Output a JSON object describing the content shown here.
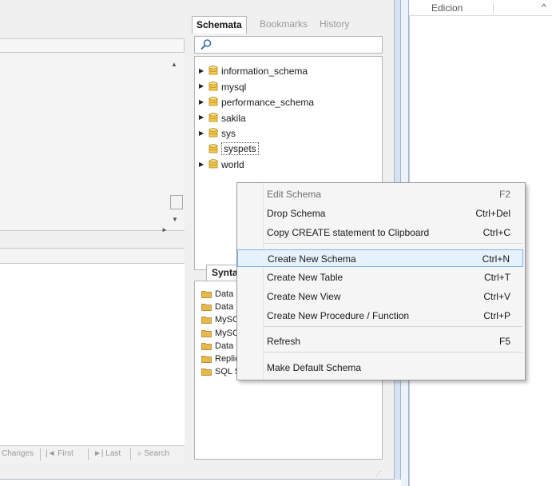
{
  "right_panel": {
    "header_label": "Edicion",
    "caret": "^"
  },
  "left_toolbar": {
    "items": [
      "Changes",
      "First",
      "Last",
      "Search"
    ]
  },
  "schemata": {
    "tabs": [
      "Schemata",
      "Bookmarks",
      "History"
    ],
    "active_tab": "Schemata",
    "search_placeholder": "",
    "schemas": [
      {
        "name": "information_schema",
        "expandable": true
      },
      {
        "name": "mysql",
        "expandable": true
      },
      {
        "name": "performance_schema",
        "expandable": true
      },
      {
        "name": "sakila",
        "expandable": true
      },
      {
        "name": "sys",
        "expandable": true
      },
      {
        "name": "syspets",
        "expandable": false,
        "selected": true
      },
      {
        "name": "world",
        "expandable": true
      }
    ]
  },
  "syntax": {
    "tab_label": "Syntax",
    "items": [
      "Data",
      "Data",
      "MySC",
      "MySC",
      "Data",
      "Replication Statements",
      "SQL Syntax for Prepared Statements"
    ]
  },
  "context_menu": {
    "groups": [
      [
        {
          "label": "Edit Schema",
          "shortcut": "F2",
          "disabled": true
        },
        {
          "label": "Drop Schema",
          "shortcut": "Ctrl+Del"
        },
        {
          "label": "Copy CREATE statement to Clipboard",
          "shortcut": "Ctrl+C"
        }
      ],
      [
        {
          "label": "Create New Schema",
          "shortcut": "Ctrl+N",
          "hover": true
        },
        {
          "label": "Create New Table",
          "shortcut": "Ctrl+T"
        },
        {
          "label": "Create New View",
          "shortcut": "Ctrl+V"
        },
        {
          "label": "Create New Procedure / Function",
          "shortcut": "Ctrl+P"
        }
      ],
      [
        {
          "label": "Refresh",
          "shortcut": "F5"
        }
      ],
      [
        {
          "label": "Make Default Schema",
          "shortcut": ""
        }
      ]
    ]
  },
  "colors": {
    "accent_hover": "#e5f1fb",
    "db_icon": "#f2c94c",
    "folder_icon": "#e8b84a"
  }
}
